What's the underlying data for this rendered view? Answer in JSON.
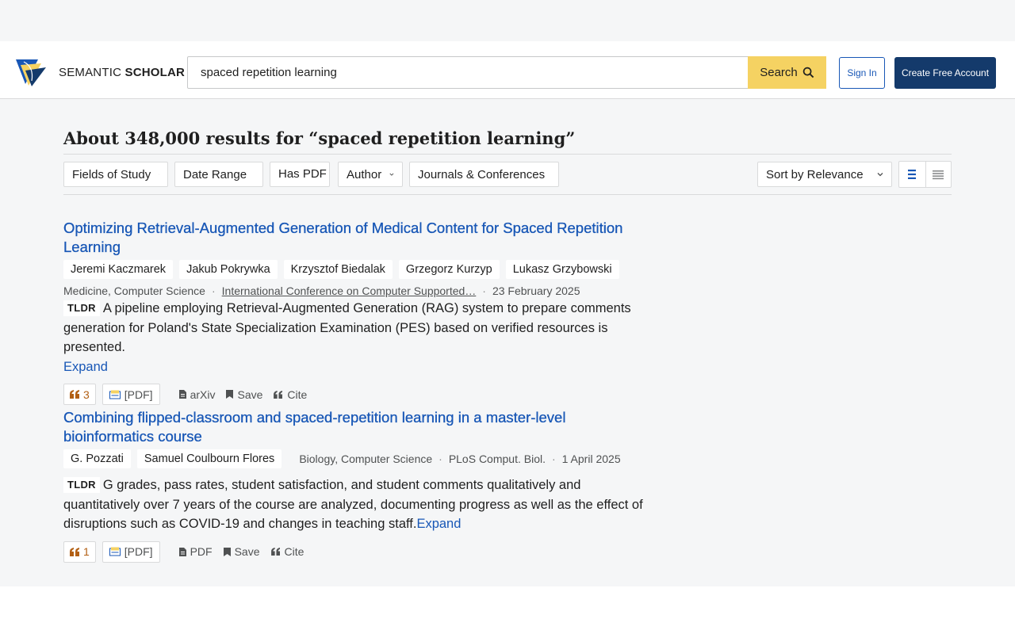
{
  "header": {
    "logo_text_regular": "SEMANTIC",
    "logo_text_bold": "SCHOLAR",
    "search_value": "spaced repetition learning",
    "search_button_label": "Search",
    "signin_label": "Sign In",
    "create_account_label": "Create Free Account"
  },
  "results": {
    "title": "About 348,000 results for “spaced repetition learning”"
  },
  "filters": {
    "fields_of_study": "Fields of Study",
    "date_range": "Date Range",
    "has_pdf": "Has PDF",
    "author": "Author",
    "journals": "Journals & Conferences",
    "sort": "Sort by Relevance"
  },
  "papers": [
    {
      "title_line1": "Optimizing Retrieval-Augmented Generation of Medical Content for Spaced Repetition",
      "title_line2": "Learning",
      "authors": [
        "Jeremi Kaczmarek",
        "Jakub Pokrywka",
        "Krzysztof Biedalak",
        "Grzegorz Kurzyp",
        "Lukasz Grzybowski"
      ],
      "fields": "Medicine, Computer Science",
      "venue": "International Conference on Computer Supported…",
      "date": "23 February 2025",
      "tldr_label": "TLDR",
      "tldr": "A pipeline employing Retrieval-Augmented Generation (RAG) system to prepare comments generation for Poland's State Specialization Examination (PES) based on verified resources is presented.",
      "expand": "Expand",
      "citations": "3",
      "pdf_label": "[PDF]",
      "source": "arXiv",
      "save": "Save",
      "cite": "Cite"
    },
    {
      "title_line1": "Combining flipped-classroom and spaced-repetition learning in a master-level",
      "title_line2": "bioinformatics course",
      "authors": [
        "G. Pozzati",
        "Samuel Coulbourn Flores"
      ],
      "fields": "Biology, Computer Science",
      "venue": "PLoS Comput. Biol.",
      "date": "1 April 2025",
      "tldr_label": "TLDR",
      "tldr": "G grades, pass rates, student satisfaction, and student comments qualitatively and quantitatively over 7 years of the course are analyzed, documenting progress as well as the effect of disruptions such as COVID-19 and changes in teaching staff.",
      "expand": "Expand",
      "citations": "1",
      "pdf_label": "[PDF]",
      "source": "PDF",
      "save": "Save",
      "cite": "Cite"
    }
  ],
  "colors": {
    "accent_blue": "#1857b6",
    "search_yellow": "#f5d262",
    "navy": "#143a6b",
    "citation_orange": "#b25f13"
  }
}
